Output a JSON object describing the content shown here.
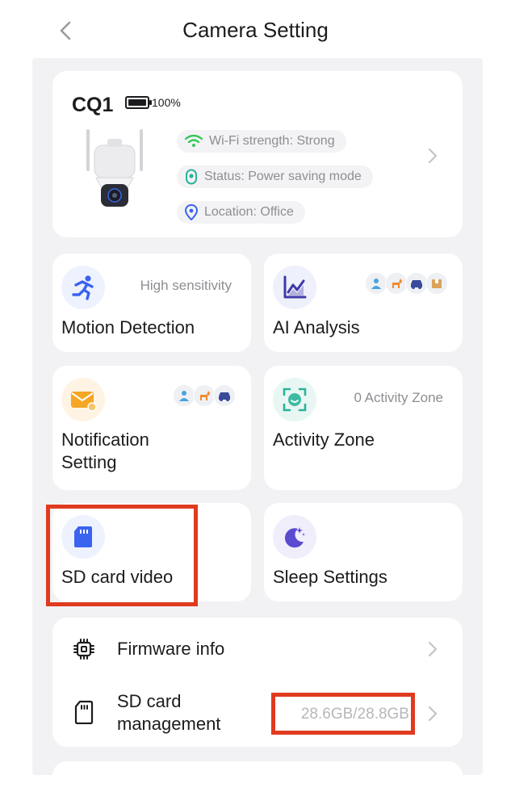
{
  "header": {
    "title": "Camera Setting",
    "back_icon": "chevron-left-icon"
  },
  "camera": {
    "name": "CQ1",
    "battery": "100%",
    "battery_level": 1.0,
    "wifi": "Wi-Fi strength: Strong",
    "status": "Status: Power saving mode",
    "location": "Location: Office"
  },
  "tiles": {
    "motion": {
      "label": "Motion Detection",
      "value": "High sensitivity"
    },
    "ai": {
      "label": "AI Analysis",
      "badges": [
        "person-icon",
        "pet-icon",
        "vehicle-icon",
        "package-icon"
      ]
    },
    "notification": {
      "label_line1": "Notification",
      "label_line2": "Setting",
      "badges": [
        "person-icon",
        "pet-icon",
        "vehicle-icon"
      ]
    },
    "zone": {
      "label": "Activity Zone",
      "value": "0 Activity Zone"
    },
    "sd": {
      "label": "SD card video"
    },
    "sleep": {
      "label": "Sleep Settings"
    }
  },
  "list": {
    "firmware": {
      "label": "Firmware info"
    },
    "sd_management": {
      "label_line1": "SD card",
      "label_line2": "management",
      "value": "28.6GB/28.8GB"
    }
  },
  "colors": {
    "highlight": "#e03a1f",
    "accent_blue": "#3a63f0",
    "wifi_green": "#34c759",
    "status_teal": "#2bb39a"
  }
}
